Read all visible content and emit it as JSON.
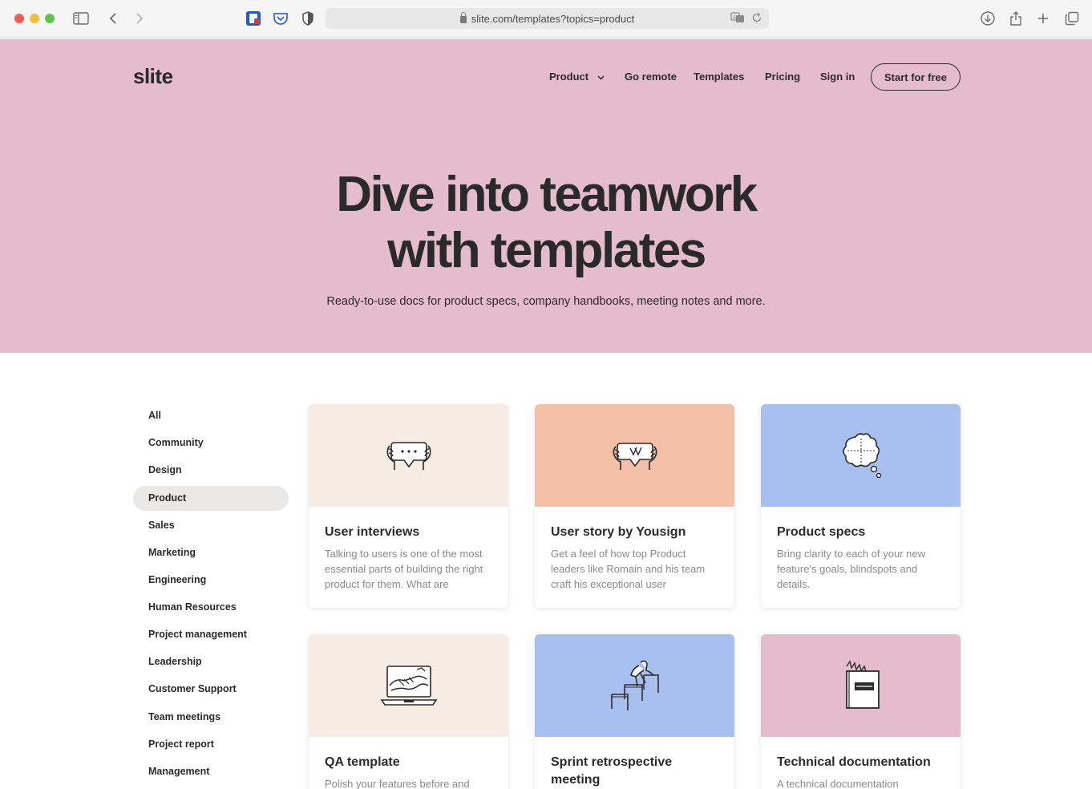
{
  "browser": {
    "url": "slite.com/templates?topics=product"
  },
  "header": {
    "logo": "slite",
    "nav": [
      {
        "label": "Product"
      },
      {
        "label": "Go remote"
      },
      {
        "label": "Templates"
      },
      {
        "label": "Pricing"
      },
      {
        "label": "Sign in"
      }
    ],
    "cta": "Start for free"
  },
  "hero": {
    "title_line1": "Dive into teamwork",
    "title_line2": "with templates",
    "subtitle": "Ready-to-use docs for product specs, company handbooks, meeting notes and more."
  },
  "sidebar": {
    "active": "Product",
    "items": [
      "All",
      "Community",
      "Design",
      "Product",
      "Sales",
      "Marketing",
      "Engineering",
      "Human Resources",
      "Project management",
      "Leadership",
      "Customer Support",
      "Team meetings",
      "Project report",
      "Management"
    ]
  },
  "cards": [
    {
      "title": "User interviews",
      "desc": "Talking to users is one of the most essential parts of building the right product for them. What are",
      "color": "#f6ece3",
      "icon": "hands-holding-speech-bubble-icon"
    },
    {
      "title": "User story by Yousign",
      "desc": "Get a feel of how top Product leaders like Romain and his team craft his exceptional user",
      "color": "#f4bfa7",
      "icon": "hands-holding-signature-icon"
    },
    {
      "title": "Product specs",
      "desc": "Bring clarity to each of your new feature's goals, blindspots and details.",
      "color": "#a8c0ef",
      "icon": "thought-bubble-icon"
    },
    {
      "title": "QA template",
      "desc": "Polish your features before and",
      "color": "#f6ece3",
      "icon": "laptop-handshake-icon"
    },
    {
      "title": "Sprint retrospective meeting",
      "desc": "",
      "color": "#a8c0ef",
      "icon": "hurdles-runner-icon"
    },
    {
      "title": "Technical documentation",
      "desc": "A technical documentation",
      "color": "#e5bccb",
      "icon": "book-icon"
    }
  ],
  "colors": {
    "hero_bg": "#e5bccb",
    "sidebar_active_bg": "#ebe9e8"
  }
}
